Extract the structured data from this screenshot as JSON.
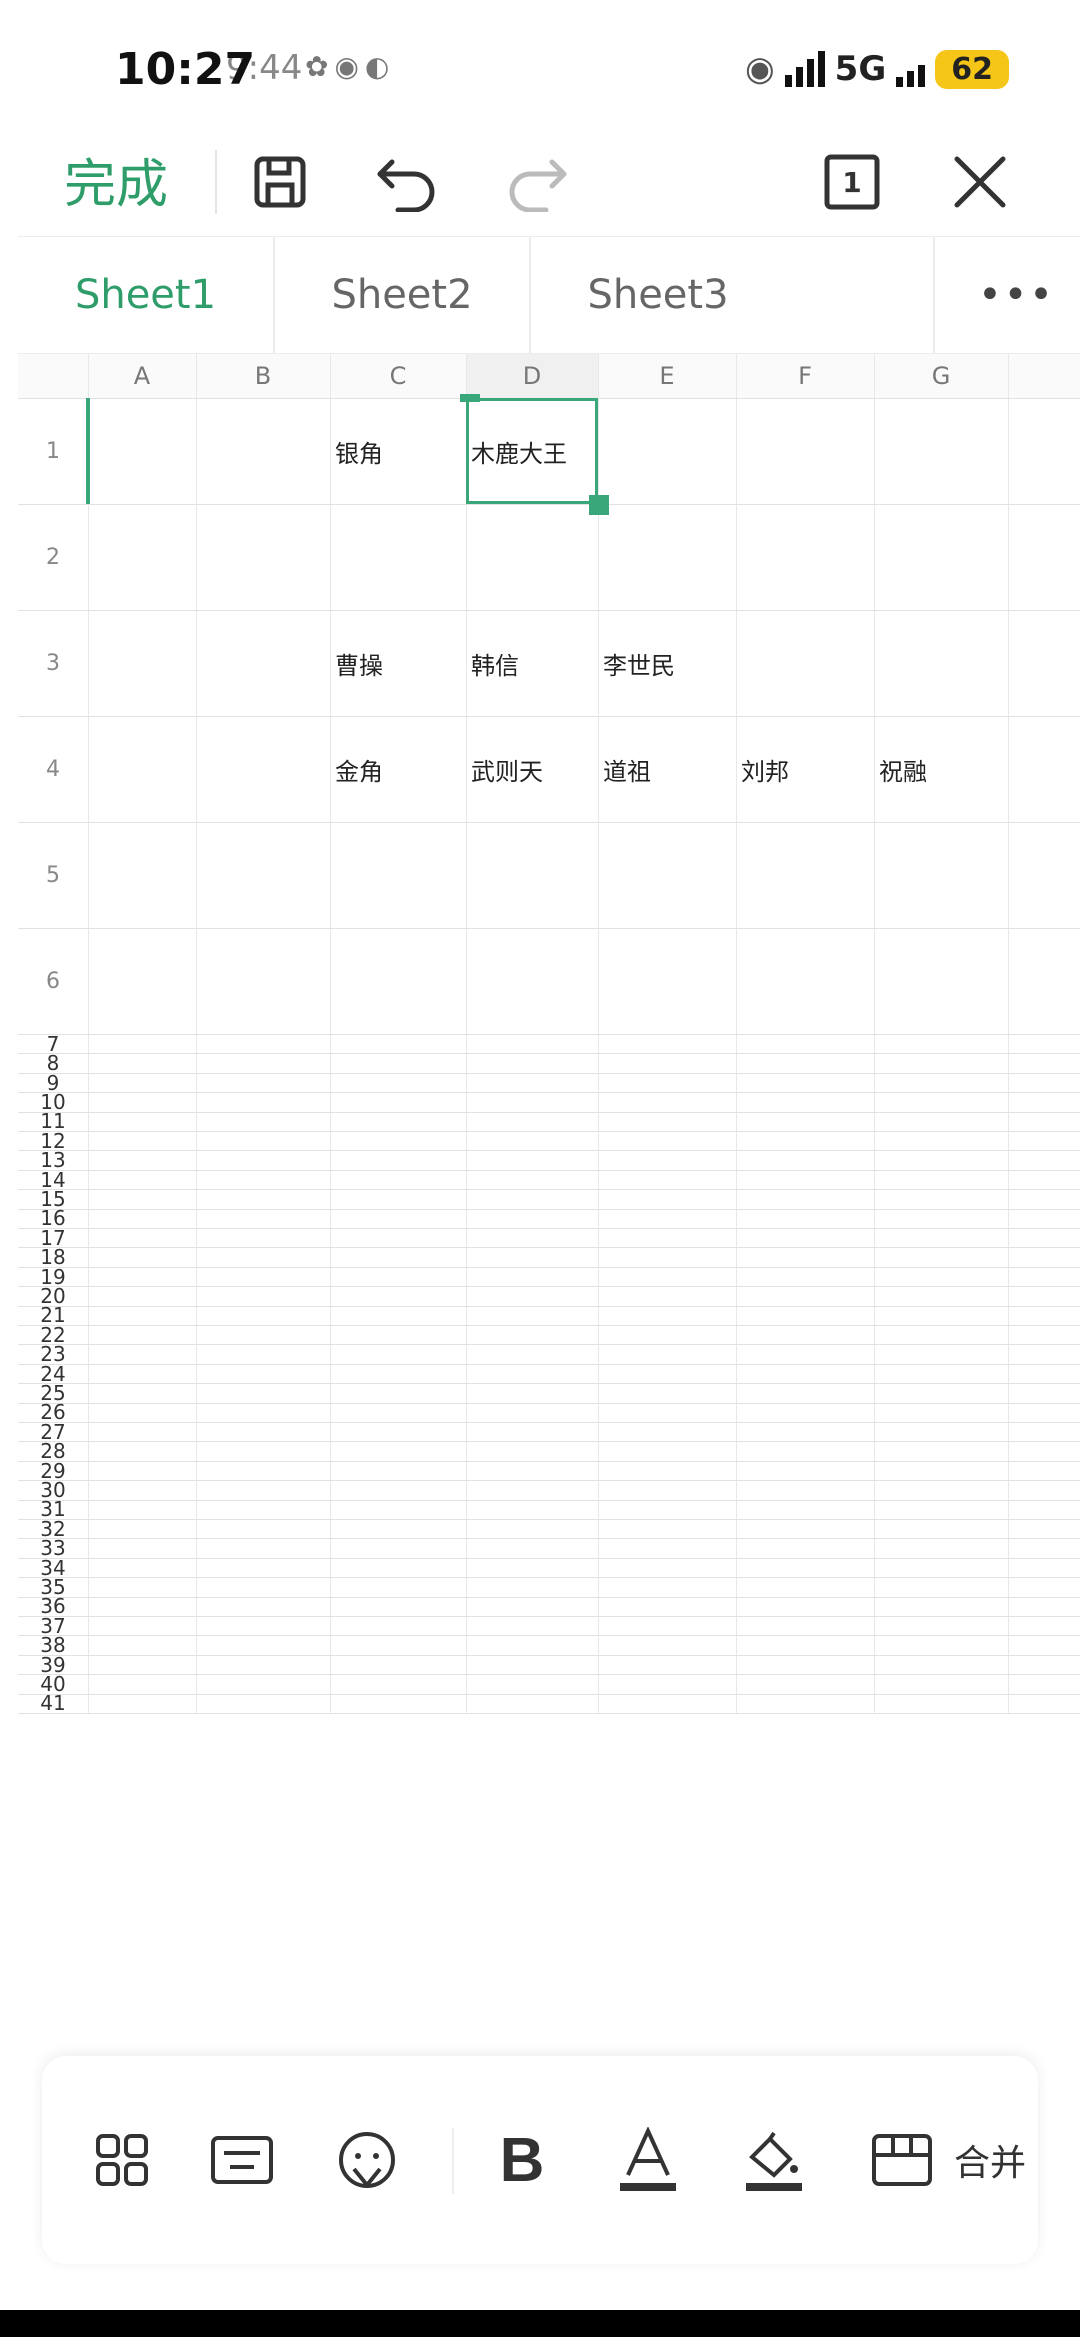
{
  "status_bar": {
    "time": "10:27",
    "time_ghost": "9:44",
    "network": "5G",
    "battery": "62"
  },
  "toolbar": {
    "done_label": "完成",
    "sheet_count": "1"
  },
  "sheet_tabs": [
    {
      "label": "Sheet1",
      "active": true
    },
    {
      "label": "Sheet2",
      "active": false
    },
    {
      "label": "Sheet3",
      "active": false
    }
  ],
  "more_label": "•••",
  "columns": [
    "A",
    "B",
    "C",
    "D",
    "E",
    "F",
    "G"
  ],
  "rows": [
    "1",
    "2",
    "3",
    "4",
    "5",
    "6",
    "7",
    "8",
    "9",
    "10",
    "11",
    "12",
    "13",
    "14",
    "15",
    "16",
    "17",
    "18",
    "19",
    "20",
    "21",
    "22",
    "23",
    "24",
    "25",
    "26",
    "27",
    "28",
    "29",
    "30",
    "31",
    "32",
    "33",
    "34",
    "35",
    "36",
    "37",
    "38",
    "39",
    "40",
    "41"
  ],
  "cells": {
    "C1": "银角",
    "D1": "木鹿大王",
    "C3": "曹操",
    "D3": "韩信",
    "E3": "李世民",
    "C4": "金角",
    "D4": "武则天",
    "E4": "道祖",
    "F4": "刘邦",
    "G4": "祝融"
  },
  "selected_cell": "D1",
  "bottom_toolbar": {
    "merge_label": "合并"
  },
  "colors": {
    "accent": "#2e9d6a",
    "selection": "#3aa77a"
  }
}
